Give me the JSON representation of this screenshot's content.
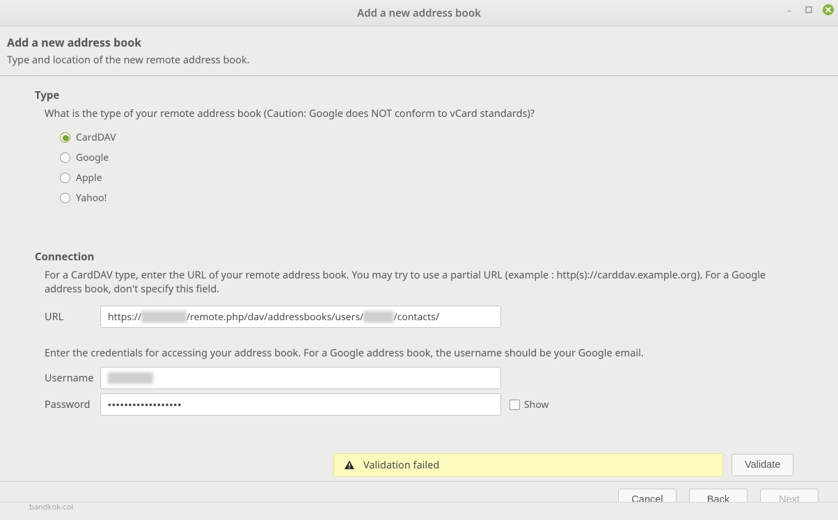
{
  "window": {
    "title": "Add a new address book"
  },
  "header": {
    "title": "Add a new address book",
    "subtitle": "Type and location of the new remote address book."
  },
  "type_section": {
    "heading": "Type",
    "question": "What is the type of your remote address book (Caution: Google does NOT conform to vCard standards)?",
    "options": [
      {
        "label": "CardDAV",
        "selected": true
      },
      {
        "label": "Google",
        "selected": false
      },
      {
        "label": "Apple",
        "selected": false
      },
      {
        "label": "Yahoo!",
        "selected": false
      }
    ]
  },
  "connection_section": {
    "heading": "Connection",
    "url_help": "For a CardDAV type, enter the URL of your remote address book. You may try to use a partial URL (example : http(s)://carddav.example.org). For a Google address book, don't specify this field.",
    "url_label": "URL",
    "url_prefix": "https://",
    "url_redacted": "██████",
    "url_mid": "/remote.php/dav/addressbooks/users/",
    "url_redacted2": "████",
    "url_suffix": "/contacts/",
    "cred_help": "Enter the credentials for accessing your address book. For a Google address book, the username should be your Google email.",
    "username_label": "Username",
    "username_value": "██████",
    "password_label": "Password",
    "password_value": "••••••••••••••••••",
    "show_label": "Show"
  },
  "validation": {
    "message": "Validation failed",
    "validate_label": "Validate"
  },
  "footer": {
    "cancel": "Cancel",
    "back_mnemonic": "B",
    "back_rest": "ack",
    "next_mnemonic": "N",
    "next_rest": "ext"
  },
  "shadow": {
    "text": "bandkok-col"
  }
}
